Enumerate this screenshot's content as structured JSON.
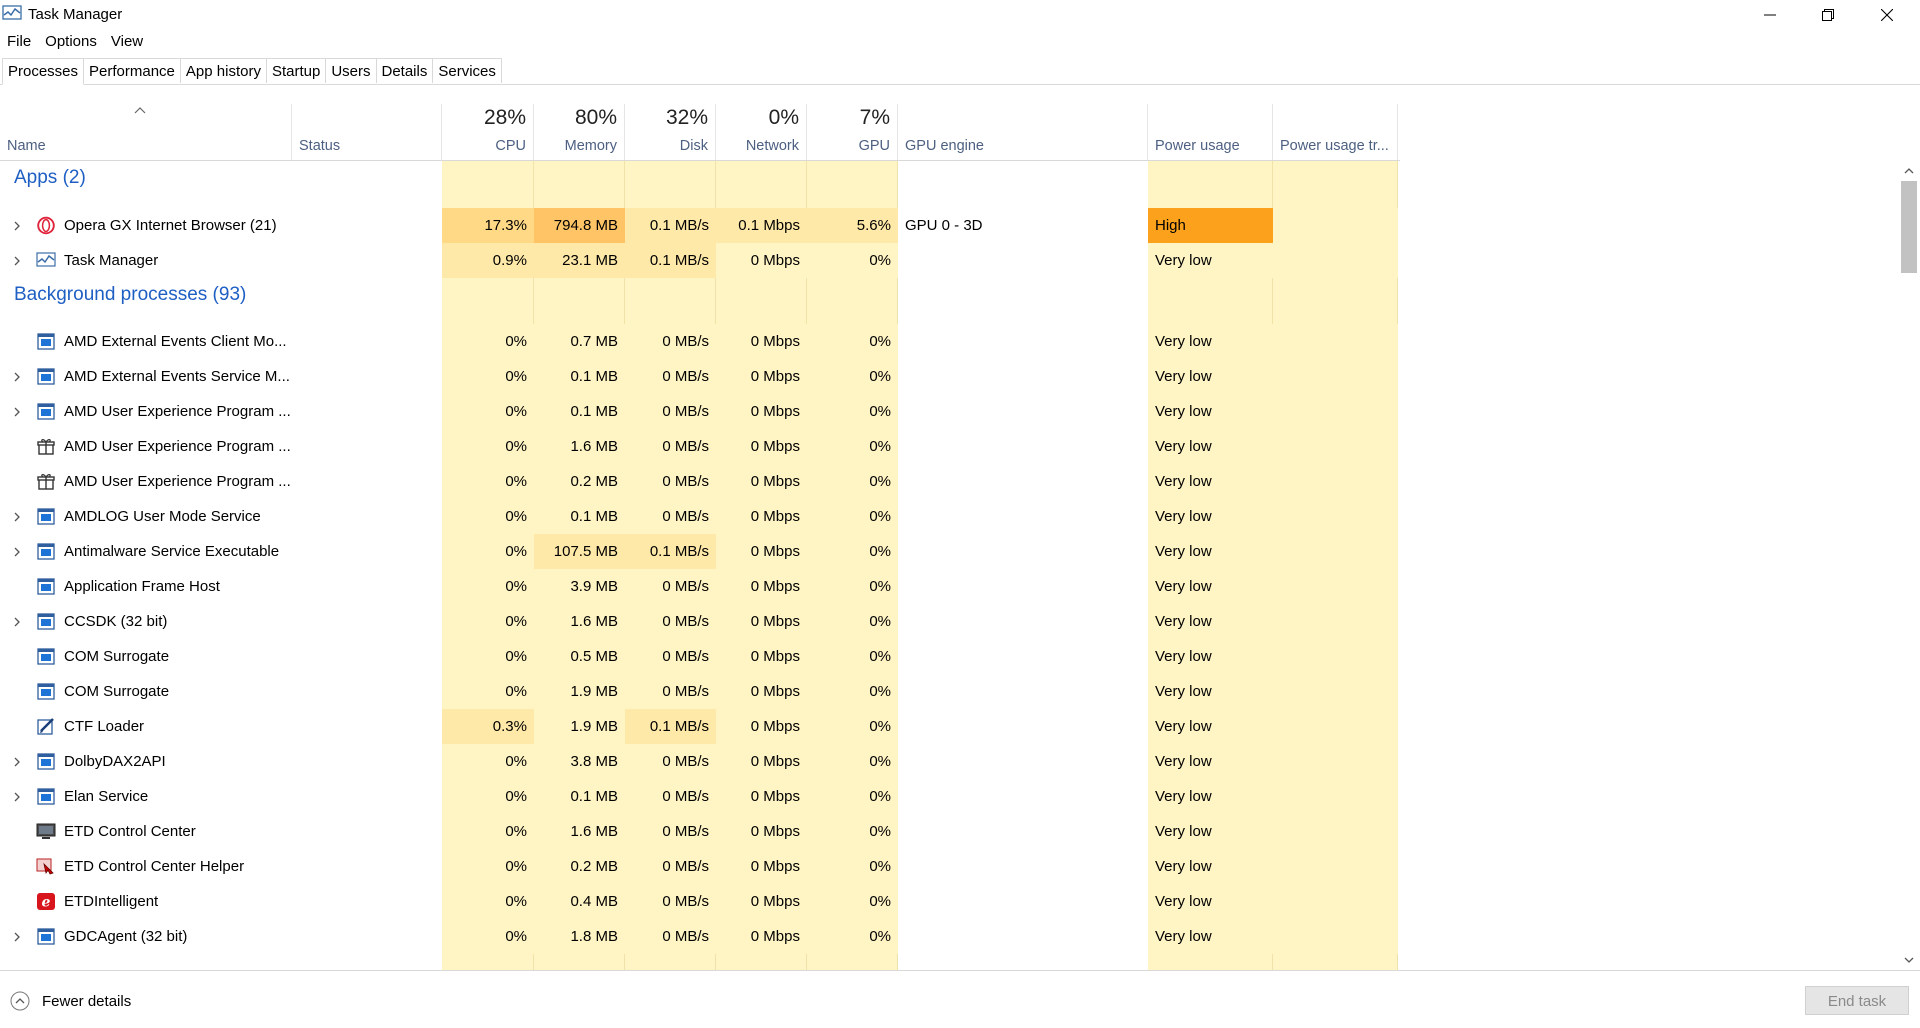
{
  "window": {
    "title": "Task Manager"
  },
  "menu": [
    "File",
    "Options",
    "View"
  ],
  "tabs": [
    {
      "label": "Processes",
      "active": true
    },
    {
      "label": "Performance",
      "active": false
    },
    {
      "label": "App history",
      "active": false
    },
    {
      "label": "Startup",
      "active": false
    },
    {
      "label": "Users",
      "active": false
    },
    {
      "label": "Details",
      "active": false
    },
    {
      "label": "Services",
      "active": false
    }
  ],
  "header": {
    "name": "Name",
    "status": "Status",
    "cpu": {
      "pct": "28%",
      "label": "CPU"
    },
    "memory": {
      "pct": "80%",
      "label": "Memory"
    },
    "disk": {
      "pct": "32%",
      "label": "Disk"
    },
    "network": {
      "pct": "0%",
      "label": "Network"
    },
    "gpu": {
      "pct": "7%",
      "label": "GPU"
    },
    "gpu_engine": "GPU engine",
    "power": "Power usage",
    "power_trend": "Power usage tr..."
  },
  "groups": [
    {
      "title": "Apps (2)",
      "rows": [
        {
          "name": "Opera GX Internet Browser (21)",
          "icon": "opera-icon",
          "expand": true,
          "cpu": "17.3%",
          "memory": "794.8 MB",
          "disk": "0.1 MB/s",
          "network": "0.1 Mbps",
          "gpu": "5.6%",
          "gpu_engine": "GPU 0 - 3D",
          "power": "High",
          "hot": {
            "cpu": 2,
            "memory": 3,
            "disk": 1,
            "network": 1,
            "gpu": 1
          }
        },
        {
          "name": "Task Manager",
          "icon": "task-manager-icon",
          "expand": true,
          "cpu": "0.9%",
          "memory": "23.1 MB",
          "disk": "0.1 MB/s",
          "network": "0 Mbps",
          "gpu": "0%",
          "gpu_engine": "",
          "power": "Very low",
          "hot": {
            "cpu": 1,
            "memory": 1,
            "disk": 1
          }
        }
      ]
    },
    {
      "title": "Background processes (93)",
      "rows": [
        {
          "name": "AMD External Events Client Mo...",
          "icon": "service-window-icon",
          "expand": false,
          "cpu": "0%",
          "memory": "0.7 MB",
          "disk": "0 MB/s",
          "network": "0 Mbps",
          "gpu": "0%",
          "gpu_engine": "",
          "power": "Very low",
          "hot": {}
        },
        {
          "name": "AMD External Events Service M...",
          "icon": "service-window-icon",
          "expand": true,
          "cpu": "0%",
          "memory": "0.1 MB",
          "disk": "0 MB/s",
          "network": "0 Mbps",
          "gpu": "0%",
          "gpu_engine": "",
          "power": "Very low",
          "hot": {}
        },
        {
          "name": "AMD User Experience Program ...",
          "icon": "service-window-icon",
          "expand": true,
          "cpu": "0%",
          "memory": "0.1 MB",
          "disk": "0 MB/s",
          "network": "0 Mbps",
          "gpu": "0%",
          "gpu_engine": "",
          "power": "Very low",
          "hot": {}
        },
        {
          "name": "AMD User Experience Program ...",
          "icon": "gift-box-icon",
          "expand": false,
          "cpu": "0%",
          "memory": "1.6 MB",
          "disk": "0 MB/s",
          "network": "0 Mbps",
          "gpu": "0%",
          "gpu_engine": "",
          "power": "Very low",
          "hot": {}
        },
        {
          "name": "AMD User Experience Program ...",
          "icon": "gift-box-icon",
          "expand": false,
          "cpu": "0%",
          "memory": "0.2 MB",
          "disk": "0 MB/s",
          "network": "0 Mbps",
          "gpu": "0%",
          "gpu_engine": "",
          "power": "Very low",
          "hot": {}
        },
        {
          "name": "AMDLOG User Mode Service",
          "icon": "service-window-icon",
          "expand": true,
          "cpu": "0%",
          "memory": "0.1 MB",
          "disk": "0 MB/s",
          "network": "0 Mbps",
          "gpu": "0%",
          "gpu_engine": "",
          "power": "Very low",
          "hot": {}
        },
        {
          "name": "Antimalware Service Executable",
          "icon": "service-window-icon",
          "expand": true,
          "cpu": "0%",
          "memory": "107.5 MB",
          "disk": "0.1 MB/s",
          "network": "0 Mbps",
          "gpu": "0%",
          "gpu_engine": "",
          "power": "Very low",
          "hot": {
            "memory": 1,
            "disk": 1
          }
        },
        {
          "name": "Application Frame Host",
          "icon": "service-window-icon",
          "expand": false,
          "cpu": "0%",
          "memory": "3.9 MB",
          "disk": "0 MB/s",
          "network": "0 Mbps",
          "gpu": "0%",
          "gpu_engine": "",
          "power": "Very low",
          "hot": {}
        },
        {
          "name": "CCSDK (32 bit)",
          "icon": "service-window-icon",
          "expand": true,
          "cpu": "0%",
          "memory": "1.6 MB",
          "disk": "0 MB/s",
          "network": "0 Mbps",
          "gpu": "0%",
          "gpu_engine": "",
          "power": "Very low",
          "hot": {}
        },
        {
          "name": "COM Surrogate",
          "icon": "service-window-icon",
          "expand": false,
          "cpu": "0%",
          "memory": "0.5 MB",
          "disk": "0 MB/s",
          "network": "0 Mbps",
          "gpu": "0%",
          "gpu_engine": "",
          "power": "Very low",
          "hot": {}
        },
        {
          "name": "COM Surrogate",
          "icon": "service-window-icon",
          "expand": false,
          "cpu": "0%",
          "memory": "1.9 MB",
          "disk": "0 MB/s",
          "network": "0 Mbps",
          "gpu": "0%",
          "gpu_engine": "",
          "power": "Very low",
          "hot": {}
        },
        {
          "name": "CTF Loader",
          "icon": "ctf-pen-icon",
          "expand": false,
          "cpu": "0.3%",
          "memory": "1.9 MB",
          "disk": "0.1 MB/s",
          "network": "0 Mbps",
          "gpu": "0%",
          "gpu_engine": "",
          "power": "Very low",
          "hot": {
            "cpu": 1,
            "disk": 1
          }
        },
        {
          "name": "DolbyDAX2API",
          "icon": "service-window-icon",
          "expand": true,
          "cpu": "0%",
          "memory": "3.8 MB",
          "disk": "0 MB/s",
          "network": "0 Mbps",
          "gpu": "0%",
          "gpu_engine": "",
          "power": "Very low",
          "hot": {}
        },
        {
          "name": "Elan Service",
          "icon": "service-window-icon",
          "expand": true,
          "cpu": "0%",
          "memory": "0.1 MB",
          "disk": "0 MB/s",
          "network": "0 Mbps",
          "gpu": "0%",
          "gpu_engine": "",
          "power": "Very low",
          "hot": {}
        },
        {
          "name": "ETD Control Center",
          "icon": "monitor-icon",
          "expand": false,
          "cpu": "0%",
          "memory": "1.6 MB",
          "disk": "0 MB/s",
          "network": "0 Mbps",
          "gpu": "0%",
          "gpu_engine": "",
          "power": "Very low",
          "hot": {}
        },
        {
          "name": "ETD Control Center Helper",
          "icon": "etd-helper-icon",
          "expand": false,
          "cpu": "0%",
          "memory": "0.2 MB",
          "disk": "0 MB/s",
          "network": "0 Mbps",
          "gpu": "0%",
          "gpu_engine": "",
          "power": "Very low",
          "hot": {}
        },
        {
          "name": "ETDIntelligent",
          "icon": "etd-intelligent-icon",
          "expand": false,
          "cpu": "0%",
          "memory": "0.4 MB",
          "disk": "0 MB/s",
          "network": "0 Mbps",
          "gpu": "0%",
          "gpu_engine": "",
          "power": "Very low",
          "hot": {}
        },
        {
          "name": "GDCAgent (32 bit)",
          "icon": "service-window-icon",
          "expand": true,
          "cpu": "0%",
          "memory": "1.8 MB",
          "disk": "0 MB/s",
          "network": "0 Mbps",
          "gpu": "0%",
          "gpu_engine": "",
          "power": "Very low",
          "hot": {}
        }
      ]
    }
  ],
  "footer": {
    "fewer_details": "Fewer details",
    "end_task": "End task"
  },
  "colors": {
    "heat0": "#fff4c4",
    "heat1": "#ffe9a8",
    "heat2": "#ffd986",
    "heat3": "#ffc466",
    "power_high": "#fba11c",
    "group_title": "#1f5fc4"
  }
}
